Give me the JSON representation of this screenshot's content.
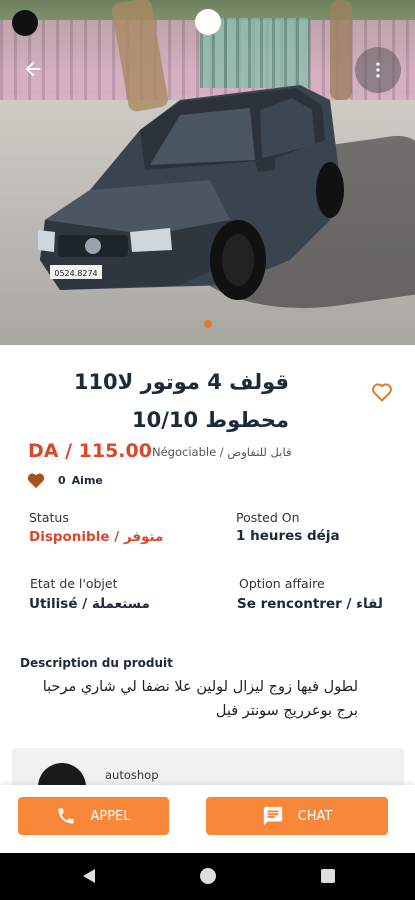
{
  "photo": {
    "alt": "",
    "car_plate": "0524.8274",
    "accent": "#e8782c"
  },
  "listing": {
    "title": "قولف 4 موتور لا110 محطوط 10/10",
    "price": "DA / 115.00",
    "negotiable": "Négociable / قابل للتفاوض",
    "likes_count": "0",
    "likes_label": "Aime"
  },
  "fields": {
    "status_label": "Status",
    "status_value": "Disponible / متوفر",
    "posted_label": "Posted On",
    "posted_value": "1 heures déja",
    "condition_label": "Etat de l'objet",
    "condition_value": "Utilisé / مستعملة",
    "option_label": "Option affaire",
    "option_value": "Se rencontrer / لقاء"
  },
  "description": {
    "label": "Description du produit",
    "text": "لطول فيها زوج ليزال لولين علا نضفا لي شاري مرحبا برج بوعرريج سونتر فيل"
  },
  "seller": {
    "name": "autoshop"
  },
  "actions": {
    "call_label": "APPEL",
    "chat_label": "CHAT"
  },
  "colors": {
    "accent": "#f7883a",
    "price": "#d9482b",
    "title": "#1c2b3a"
  },
  "icons": {
    "back": "arrow-left-icon",
    "more": "more-vert-icon",
    "favorite": "heart-outline-icon",
    "like": "heart-filled-icon",
    "call": "phone-icon",
    "chat": "chat-bubble-icon"
  }
}
